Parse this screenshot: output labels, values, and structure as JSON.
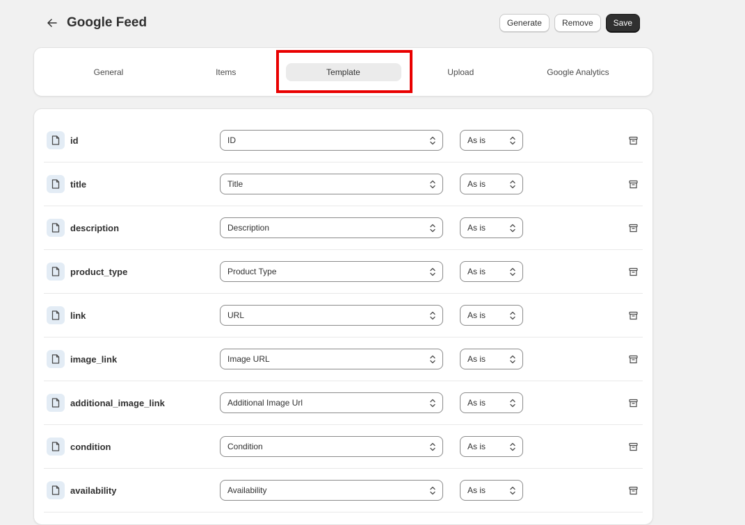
{
  "header": {
    "title": "Google Feed",
    "actions": {
      "generate": "Generate",
      "remove": "Remove",
      "save": "Save"
    }
  },
  "tabs": [
    {
      "label": "General"
    },
    {
      "label": "Items"
    },
    {
      "label": "Template",
      "active": true
    },
    {
      "label": "Upload"
    },
    {
      "label": "Google Analytics"
    }
  ],
  "rows": [
    {
      "field": "id",
      "source": "ID",
      "modifier": "As is"
    },
    {
      "field": "title",
      "source": "Title",
      "modifier": "As is"
    },
    {
      "field": "description",
      "source": "Description",
      "modifier": "As is"
    },
    {
      "field": "product_type",
      "source": "Product Type",
      "modifier": "As is"
    },
    {
      "field": "link",
      "source": "URL",
      "modifier": "As is"
    },
    {
      "field": "image_link",
      "source": "Image URL",
      "modifier": "As is"
    },
    {
      "field": "additional_image_link",
      "source": "Additional Image Url",
      "modifier": "As is"
    },
    {
      "field": "condition",
      "source": "Condition",
      "modifier": "As is"
    },
    {
      "field": "availability",
      "source": "Availability",
      "modifier": "As is"
    }
  ],
  "colors": {
    "highlight": "#e90000",
    "primary_button": "#303030",
    "icon_bg": "#e3ecf5"
  }
}
